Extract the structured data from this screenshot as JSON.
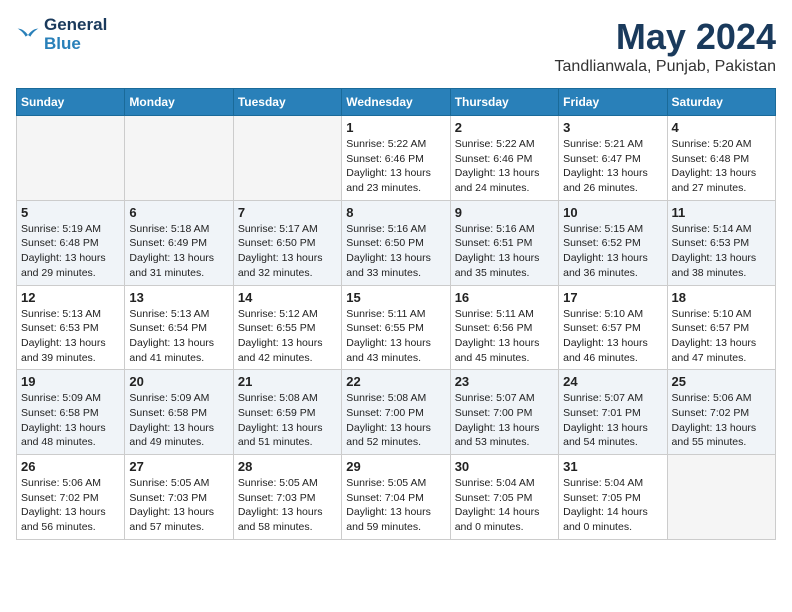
{
  "header": {
    "logo_line1": "General",
    "logo_line2": "Blue",
    "month_year": "May 2024",
    "location": "Tandlianwala, Punjab, Pakistan"
  },
  "weekdays": [
    "Sunday",
    "Monday",
    "Tuesday",
    "Wednesday",
    "Thursday",
    "Friday",
    "Saturday"
  ],
  "weeks": [
    [
      {
        "day": "",
        "lines": []
      },
      {
        "day": "",
        "lines": []
      },
      {
        "day": "",
        "lines": []
      },
      {
        "day": "1",
        "lines": [
          "Sunrise: 5:22 AM",
          "Sunset: 6:46 PM",
          "Daylight: 13 hours",
          "and 23 minutes."
        ]
      },
      {
        "day": "2",
        "lines": [
          "Sunrise: 5:22 AM",
          "Sunset: 6:46 PM",
          "Daylight: 13 hours",
          "and 24 minutes."
        ]
      },
      {
        "day": "3",
        "lines": [
          "Sunrise: 5:21 AM",
          "Sunset: 6:47 PM",
          "Daylight: 13 hours",
          "and 26 minutes."
        ]
      },
      {
        "day": "4",
        "lines": [
          "Sunrise: 5:20 AM",
          "Sunset: 6:48 PM",
          "Daylight: 13 hours",
          "and 27 minutes."
        ]
      }
    ],
    [
      {
        "day": "5",
        "lines": [
          "Sunrise: 5:19 AM",
          "Sunset: 6:48 PM",
          "Daylight: 13 hours",
          "and 29 minutes."
        ]
      },
      {
        "day": "6",
        "lines": [
          "Sunrise: 5:18 AM",
          "Sunset: 6:49 PM",
          "Daylight: 13 hours",
          "and 31 minutes."
        ]
      },
      {
        "day": "7",
        "lines": [
          "Sunrise: 5:17 AM",
          "Sunset: 6:50 PM",
          "Daylight: 13 hours",
          "and 32 minutes."
        ]
      },
      {
        "day": "8",
        "lines": [
          "Sunrise: 5:16 AM",
          "Sunset: 6:50 PM",
          "Daylight: 13 hours",
          "and 33 minutes."
        ]
      },
      {
        "day": "9",
        "lines": [
          "Sunrise: 5:16 AM",
          "Sunset: 6:51 PM",
          "Daylight: 13 hours",
          "and 35 minutes."
        ]
      },
      {
        "day": "10",
        "lines": [
          "Sunrise: 5:15 AM",
          "Sunset: 6:52 PM",
          "Daylight: 13 hours",
          "and 36 minutes."
        ]
      },
      {
        "day": "11",
        "lines": [
          "Sunrise: 5:14 AM",
          "Sunset: 6:53 PM",
          "Daylight: 13 hours",
          "and 38 minutes."
        ]
      }
    ],
    [
      {
        "day": "12",
        "lines": [
          "Sunrise: 5:13 AM",
          "Sunset: 6:53 PM",
          "Daylight: 13 hours",
          "and 39 minutes."
        ]
      },
      {
        "day": "13",
        "lines": [
          "Sunrise: 5:13 AM",
          "Sunset: 6:54 PM",
          "Daylight: 13 hours",
          "and 41 minutes."
        ]
      },
      {
        "day": "14",
        "lines": [
          "Sunrise: 5:12 AM",
          "Sunset: 6:55 PM",
          "Daylight: 13 hours",
          "and 42 minutes."
        ]
      },
      {
        "day": "15",
        "lines": [
          "Sunrise: 5:11 AM",
          "Sunset: 6:55 PM",
          "Daylight: 13 hours",
          "and 43 minutes."
        ]
      },
      {
        "day": "16",
        "lines": [
          "Sunrise: 5:11 AM",
          "Sunset: 6:56 PM",
          "Daylight: 13 hours",
          "and 45 minutes."
        ]
      },
      {
        "day": "17",
        "lines": [
          "Sunrise: 5:10 AM",
          "Sunset: 6:57 PM",
          "Daylight: 13 hours",
          "and 46 minutes."
        ]
      },
      {
        "day": "18",
        "lines": [
          "Sunrise: 5:10 AM",
          "Sunset: 6:57 PM",
          "Daylight: 13 hours",
          "and 47 minutes."
        ]
      }
    ],
    [
      {
        "day": "19",
        "lines": [
          "Sunrise: 5:09 AM",
          "Sunset: 6:58 PM",
          "Daylight: 13 hours",
          "and 48 minutes."
        ]
      },
      {
        "day": "20",
        "lines": [
          "Sunrise: 5:09 AM",
          "Sunset: 6:58 PM",
          "Daylight: 13 hours",
          "and 49 minutes."
        ]
      },
      {
        "day": "21",
        "lines": [
          "Sunrise: 5:08 AM",
          "Sunset: 6:59 PM",
          "Daylight: 13 hours",
          "and 51 minutes."
        ]
      },
      {
        "day": "22",
        "lines": [
          "Sunrise: 5:08 AM",
          "Sunset: 7:00 PM",
          "Daylight: 13 hours",
          "and 52 minutes."
        ]
      },
      {
        "day": "23",
        "lines": [
          "Sunrise: 5:07 AM",
          "Sunset: 7:00 PM",
          "Daylight: 13 hours",
          "and 53 minutes."
        ]
      },
      {
        "day": "24",
        "lines": [
          "Sunrise: 5:07 AM",
          "Sunset: 7:01 PM",
          "Daylight: 13 hours",
          "and 54 minutes."
        ]
      },
      {
        "day": "25",
        "lines": [
          "Sunrise: 5:06 AM",
          "Sunset: 7:02 PM",
          "Daylight: 13 hours",
          "and 55 minutes."
        ]
      }
    ],
    [
      {
        "day": "26",
        "lines": [
          "Sunrise: 5:06 AM",
          "Sunset: 7:02 PM",
          "Daylight: 13 hours",
          "and 56 minutes."
        ]
      },
      {
        "day": "27",
        "lines": [
          "Sunrise: 5:05 AM",
          "Sunset: 7:03 PM",
          "Daylight: 13 hours",
          "and 57 minutes."
        ]
      },
      {
        "day": "28",
        "lines": [
          "Sunrise: 5:05 AM",
          "Sunset: 7:03 PM",
          "Daylight: 13 hours",
          "and 58 minutes."
        ]
      },
      {
        "day": "29",
        "lines": [
          "Sunrise: 5:05 AM",
          "Sunset: 7:04 PM",
          "Daylight: 13 hours",
          "and 59 minutes."
        ]
      },
      {
        "day": "30",
        "lines": [
          "Sunrise: 5:04 AM",
          "Sunset: 7:05 PM",
          "Daylight: 14 hours",
          "and 0 minutes."
        ]
      },
      {
        "day": "31",
        "lines": [
          "Sunrise: 5:04 AM",
          "Sunset: 7:05 PM",
          "Daylight: 14 hours",
          "and 0 minutes."
        ]
      },
      {
        "day": "",
        "lines": []
      }
    ]
  ]
}
